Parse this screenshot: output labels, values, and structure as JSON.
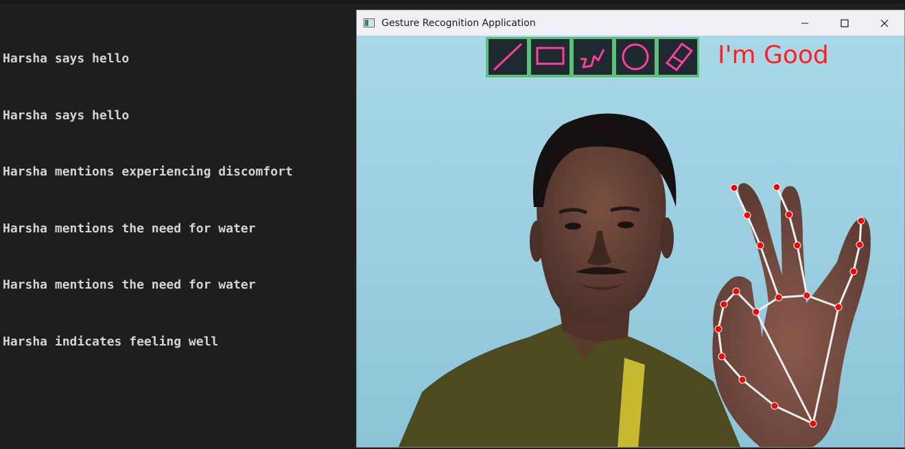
{
  "terminal": {
    "lines": [
      "Harsha says hello",
      "Harsha says hello",
      "Harsha mentions experiencing discomfort",
      "Harsha mentions the need for water",
      "Harsha mentions the need for water",
      "Harsha indicates feeling well"
    ]
  },
  "window": {
    "title": "Gesture Recognition Application",
    "controls": [
      "minimize-icon",
      "maximize-icon",
      "close-icon"
    ]
  },
  "toolbar": {
    "tools": [
      "line-tool-icon",
      "rectangle-tool-icon",
      "freehand-tool-icon",
      "circle-tool-icon",
      "eraser-tool-icon"
    ],
    "border_color": "#5cbf7a",
    "stroke_color": "#ff3fa0"
  },
  "overlay": {
    "status_text": "I'm Good",
    "status_color": "#ff1f1f"
  },
  "colors": {
    "background": "#1e1e1e",
    "terminal_text": "#d4d4d4",
    "landmark": "#ff0000",
    "skeleton": "#f0f0f0"
  }
}
